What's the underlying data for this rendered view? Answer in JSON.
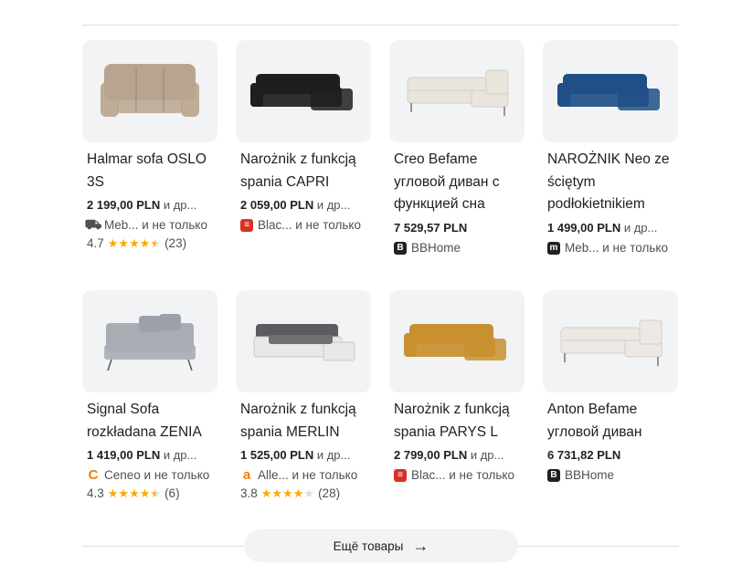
{
  "products": [
    {
      "title": "Halmar sofa OSLO 3S",
      "price": "2 199,00 PLN",
      "more": "и др...",
      "store": "Meb... и не только",
      "store_icon": "sofa-icon",
      "rating": "4.7",
      "stars": 4.5,
      "reviews": "(23)",
      "sofa_color": "#b9a58f"
    },
    {
      "title": "Narożnik z funkcją spania CAPRI",
      "price": "2 059,00 PLN",
      "more": "и др...",
      "store": "Blac... и не только",
      "store_icon": "blackred-icon",
      "sofa_color": "#1e1e1e"
    },
    {
      "title": "Creo Befame угловой диван с функцией сна",
      "price": "7 529,57 PLN",
      "more": "",
      "store": "BBHome",
      "store_icon": "bbhome-icon",
      "sofa_color": "#e9e4dc"
    },
    {
      "title": "NAROŻNIK Neo ze ściętym podłokietnikiem",
      "price": "1 499,00 PLN",
      "more": "и др...",
      "store": "Meb... и не только",
      "store_icon": "meb-icon",
      "sofa_color": "#1f4f86"
    },
    {
      "title": "Signal Sofa rozkładana ZENIA",
      "price": "1 419,00 PLN",
      "more": "и др...",
      "store": "Ceneo и не только",
      "store_icon": "ceneo-icon",
      "rating": "4.3",
      "stars": 4.5,
      "reviews": "(6)",
      "sofa_color": "#a9acb3"
    },
    {
      "title": "Narożnik z funkcją spania MERLIN",
      "price": "1 525,00 PLN",
      "more": "и др...",
      "store": "Alle... и не только",
      "store_icon": "allegro-icon",
      "rating": "3.8",
      "stars": 4,
      "reviews": "(28)",
      "sofa_color": "#5a5c60"
    },
    {
      "title": "Narożnik z funkcją spania PARYS L",
      "price": "2 799,00 PLN",
      "more": "и др...",
      "store": "Blac... и не только",
      "store_icon": "blackred-icon",
      "sofa_color": "#c8902f"
    },
    {
      "title": "Anton Befame угловой диван",
      "price": "6 731,82 PLN",
      "more": "",
      "store": "BBHome",
      "store_icon": "bbhome-icon",
      "sofa_color": "#ece9e4"
    }
  ],
  "more_button": {
    "label": "Ещё товары",
    "icon": "arrow-right-icon"
  }
}
